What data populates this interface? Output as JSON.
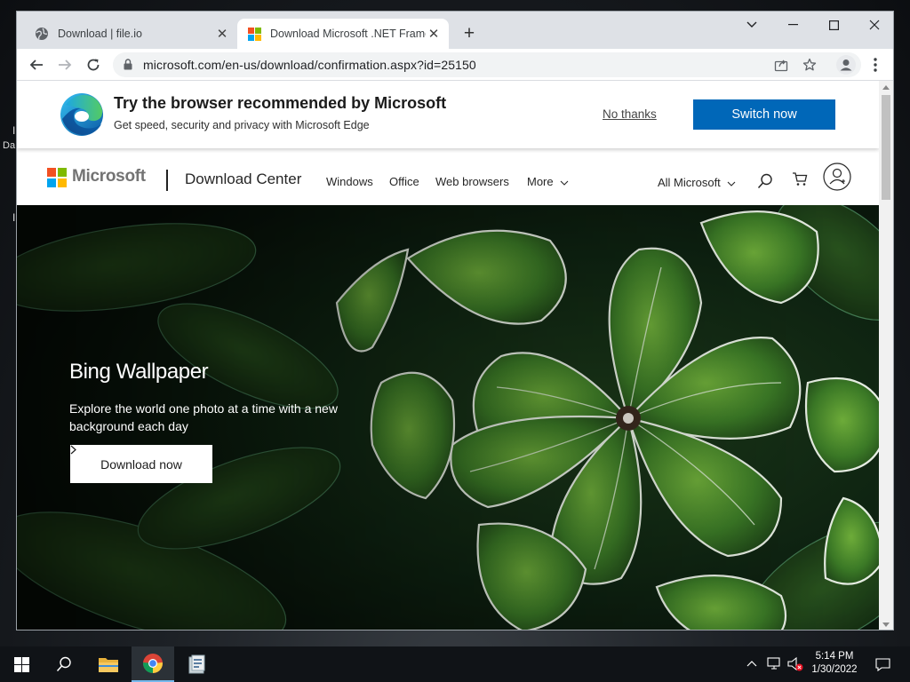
{
  "browser": {
    "tabs": [
      {
        "title": "Download | file.io",
        "active": false,
        "favicon": "globe-icon"
      },
      {
        "title": "Download Microsoft .NET Framew",
        "active": true,
        "favicon": "microsoft-logo-icon"
      }
    ],
    "new_tab": "+",
    "address": "microsoft.com/en-us/download/confirmation.aspx?id=25150"
  },
  "banner": {
    "title": "Try the browser recommended by Microsoft",
    "subtitle": "Get speed, security and privacy with Microsoft Edge",
    "dismiss": "No thanks",
    "cta": "Switch now"
  },
  "header": {
    "brand": "Microsoft",
    "section": "Download Center",
    "nav": [
      "Windows",
      "Office",
      "Web browsers",
      "More"
    ],
    "all_microsoft": "All Microsoft"
  },
  "hero": {
    "title": "Bing Wallpaper",
    "description": "Explore the world one photo at a time with a new background each day",
    "button": "Download now"
  },
  "desktop": {
    "edge_text_1": "I",
    "edge_text_2": "Da",
    "edge_text_3": "I"
  },
  "taskbar": {
    "time": "5:14 PM",
    "date": "1/30/2022"
  },
  "colors": {
    "accent": "#0067b8",
    "ms_red": "#f25022",
    "ms_green": "#7fba00",
    "ms_blue": "#00a4ef",
    "ms_yellow": "#ffb900"
  }
}
